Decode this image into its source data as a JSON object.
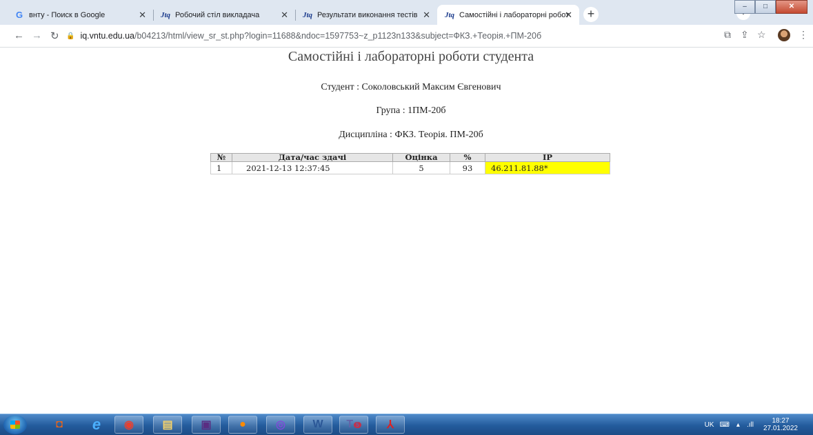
{
  "browser": {
    "tabs": [
      {
        "icon": "google-icon",
        "title": "внту - Поиск в Google",
        "active": false
      },
      {
        "icon": "jtq-icon",
        "title": "Робочий стіл викладача",
        "active": false
      },
      {
        "icon": "jtq-icon",
        "title": "Результати виконання тестів",
        "active": false
      },
      {
        "icon": "jtq-icon",
        "title": "Самостійні і лабораторні робот",
        "active": true
      }
    ],
    "url_host": "iq.vntu.edu.ua",
    "url_path": "/b04213/html/view_sr_st.php?login=11688&ndoc=1597753~z_p1123n133&subject=ФКЗ.+Теорія.+ПМ-20б"
  },
  "page": {
    "title": "Самостійні і лабораторні роботи студента",
    "student": "Студент : Соколовський Максим Євгенович",
    "group": "Група : 1ПМ-20б",
    "discipline": "Дисципліна : ФКЗ. Теорія. ПМ-20б",
    "table": {
      "headers": [
        "№",
        "Дата/час здачі",
        "Оцінка",
        "%",
        "IP"
      ],
      "rows": [
        [
          "1",
          "2021-12-13 12:37:45",
          "5",
          "93",
          "46.211.81.88*"
        ]
      ],
      "highlight_color": "#ffff00"
    }
  },
  "taskbar": {
    "items": [
      "ie-icon",
      "office-icon",
      "edge-icon",
      "chrome-icon",
      "explorer-icon",
      "save-icon",
      "firefox-icon",
      "viber-icon",
      "word-icon",
      "teams-icon",
      "acrobat-icon"
    ],
    "teams_badge": "5",
    "lang": "UK",
    "time": "18:27",
    "date": "27.01.2022"
  }
}
